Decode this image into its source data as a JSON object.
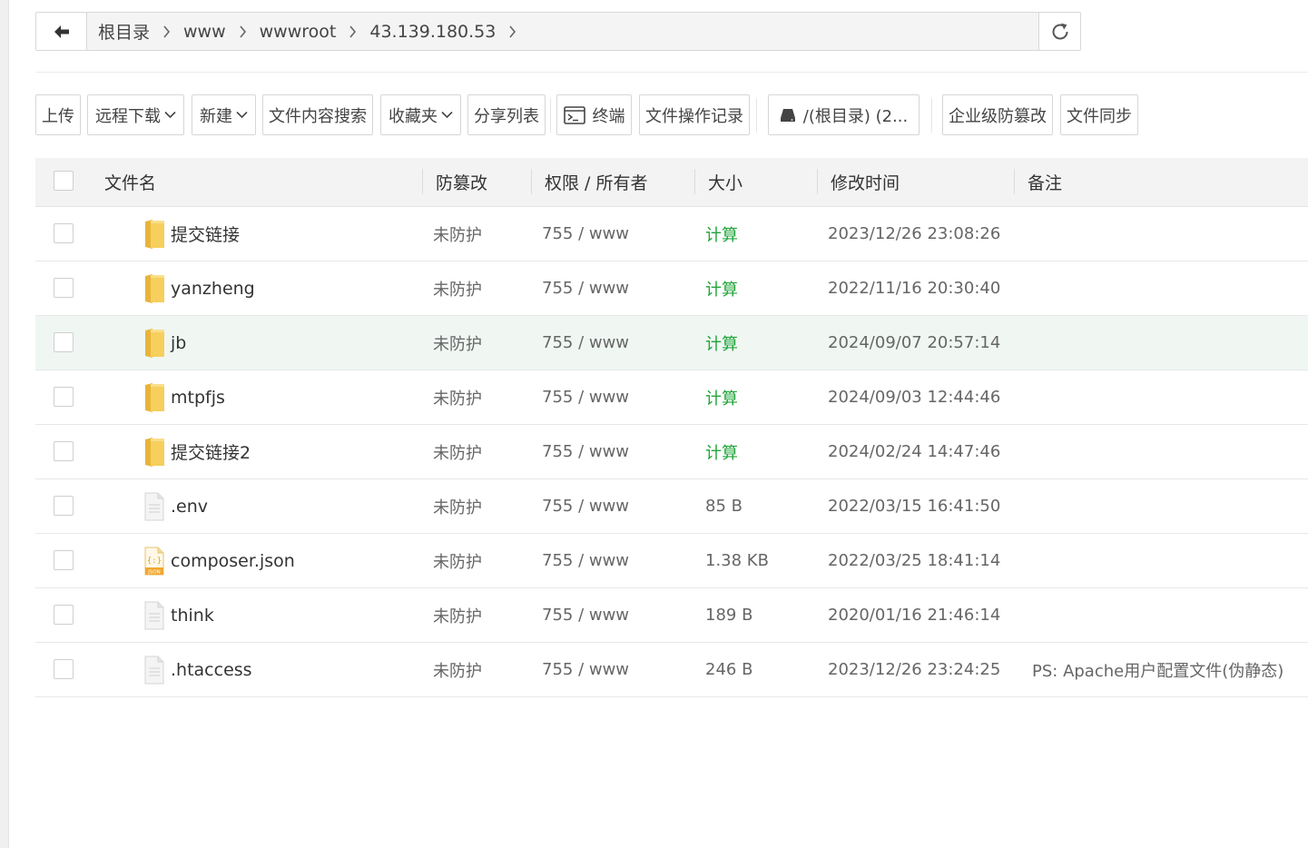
{
  "breadcrumb": {
    "items": [
      "根目录",
      "www",
      "wwwroot",
      "43.139.180.53"
    ]
  },
  "toolbar": {
    "upload": "上传",
    "remote_download": "远程下载",
    "new": "新建",
    "content_search": "文件内容搜索",
    "favorites": "收藏夹",
    "share_list": "分享列表",
    "terminal": "终端",
    "file_op_log": "文件操作记录",
    "disk": "/(根目录) (2...",
    "enterprise_tamper": "企业级防篡改",
    "file_sync": "文件同步"
  },
  "table": {
    "headers": {
      "name": "文件名",
      "tamper": "防篡改",
      "perm": "权限 / 所有者",
      "size": "大小",
      "mtime": "修改时间",
      "note": "备注"
    },
    "rows": [
      {
        "name": "提交链接",
        "tamper": "未防护",
        "perm": "755 / www",
        "size": "计算",
        "mtime": "2023/12/26 23:08:26",
        "note": ""
      },
      {
        "name": "yanzheng",
        "tamper": "未防护",
        "perm": "755 / www",
        "size": "计算",
        "mtime": "2022/11/16 20:30:40",
        "note": ""
      },
      {
        "name": "jb",
        "tamper": "未防护",
        "perm": "755 / www",
        "size": "计算",
        "mtime": "2024/09/07 20:57:14",
        "note": ""
      },
      {
        "name": "mtpfjs",
        "tamper": "未防护",
        "perm": "755 / www",
        "size": "计算",
        "mtime": "2024/09/03 12:44:46",
        "note": ""
      },
      {
        "name": "提交链接2",
        "tamper": "未防护",
        "perm": "755 / www",
        "size": "计算",
        "mtime": "2024/02/24 14:47:46",
        "note": ""
      },
      {
        "name": ".env",
        "tamper": "未防护",
        "perm": "755 / www",
        "size": "85 B",
        "mtime": "2022/03/15 16:41:50",
        "note": ""
      },
      {
        "name": "composer.json",
        "tamper": "未防护",
        "perm": "755 / www",
        "size": "1.38 KB",
        "mtime": "2022/03/25 18:41:14",
        "note": ""
      },
      {
        "name": "think",
        "tamper": "未防护",
        "perm": "755 / www",
        "size": "189 B",
        "mtime": "2020/01/16 21:46:14",
        "note": ""
      },
      {
        "name": ".htaccess",
        "tamper": "未防护",
        "perm": "755 / www",
        "size": "246 B",
        "mtime": "2023/12/26 23:24:25",
        "note": "PS: Apache用户配置文件(伪静态)"
      }
    ]
  },
  "icons": {
    "folder": "folder-icon",
    "file": "file-icon",
    "json": "json-file-icon"
  },
  "colors": {
    "accent_green": "#20a53a",
    "folder_yellow": "#f5c94a",
    "row_highlight": "#f0f7f3"
  }
}
